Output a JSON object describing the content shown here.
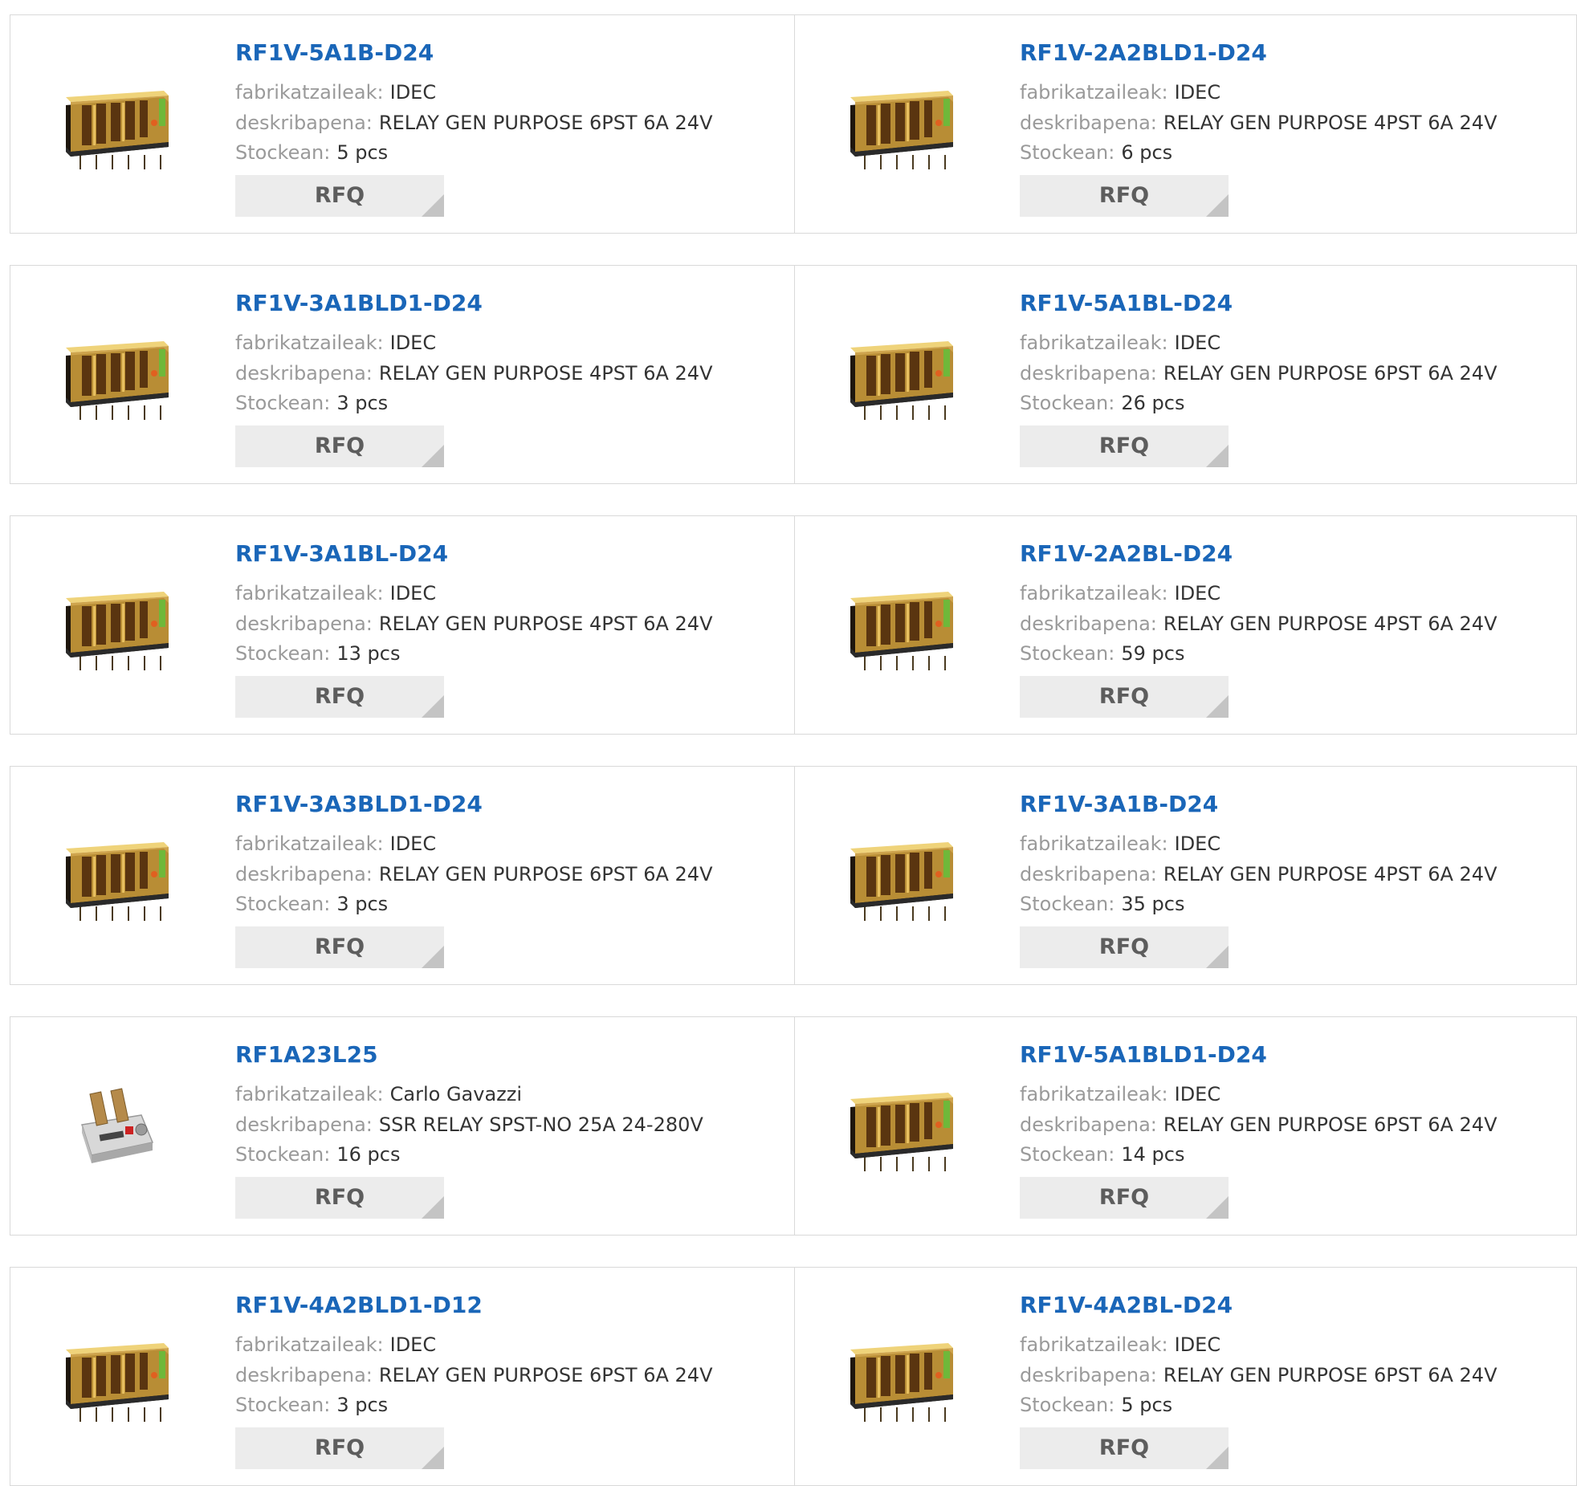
{
  "labels": {
    "manufacturer": "fabrikatzaileak:",
    "description": "deskribapena:",
    "stock": "Stockean:",
    "rfq": "RFQ"
  },
  "products": [
    {
      "pn": "RF1V-5A1B-D24",
      "manufacturer": "IDEC",
      "description": "RELAY GEN PURPOSE 6PST 6A 24V",
      "stock": "5 pcs",
      "image": "relay-icon"
    },
    {
      "pn": "RF1V-2A2BLD1-D24",
      "manufacturer": "IDEC",
      "description": "RELAY GEN PURPOSE 4PST 6A 24V",
      "stock": "6 pcs",
      "image": "relay-icon"
    },
    {
      "pn": "RF1V-3A1BLD1-D24",
      "manufacturer": "IDEC",
      "description": "RELAY GEN PURPOSE 4PST 6A 24V",
      "stock": "3 pcs",
      "image": "relay-icon"
    },
    {
      "pn": "RF1V-5A1BL-D24",
      "manufacturer": "IDEC",
      "description": "RELAY GEN PURPOSE 6PST 6A 24V",
      "stock": "26 pcs",
      "image": "relay-icon"
    },
    {
      "pn": "RF1V-3A1BL-D24",
      "manufacturer": "IDEC",
      "description": "RELAY GEN PURPOSE 4PST 6A 24V",
      "stock": "13 pcs",
      "image": "relay-icon"
    },
    {
      "pn": "RF1V-2A2BL-D24",
      "manufacturer": "IDEC",
      "description": "RELAY GEN PURPOSE 4PST 6A 24V",
      "stock": "59 pcs",
      "image": "relay-icon"
    },
    {
      "pn": "RF1V-3A3BLD1-D24",
      "manufacturer": "IDEC",
      "description": "RELAY GEN PURPOSE 6PST 6A 24V",
      "stock": "3 pcs",
      "image": "relay-icon"
    },
    {
      "pn": "RF1V-3A1B-D24",
      "manufacturer": "IDEC",
      "description": "RELAY GEN PURPOSE 4PST 6A 24V",
      "stock": "35 pcs",
      "image": "relay-icon"
    },
    {
      "pn": "RF1A23L25",
      "manufacturer": "Carlo Gavazzi",
      "description": "SSR RELAY SPST-NO 25A 24-280V",
      "stock": "16 pcs",
      "image": "ssr-icon"
    },
    {
      "pn": "RF1V-5A1BLD1-D24",
      "manufacturer": "IDEC",
      "description": "RELAY GEN PURPOSE 6PST 6A 24V",
      "stock": "14 pcs",
      "image": "relay-icon"
    },
    {
      "pn": "RF1V-4A2BLD1-D12",
      "manufacturer": "IDEC",
      "description": "RELAY GEN PURPOSE 6PST 6A 24V",
      "stock": "3 pcs",
      "image": "relay-icon"
    },
    {
      "pn": "RF1V-4A2BL-D24",
      "manufacturer": "IDEC",
      "description": "RELAY GEN PURPOSE 6PST 6A 24V",
      "stock": "5 pcs",
      "image": "relay-icon"
    }
  ],
  "colors": {
    "part_number": "#1a66b8",
    "label": "#9a9a9a",
    "value": "#333333",
    "button_bg": "#ececec",
    "button_text": "#5d5d5d",
    "border": "#d9d9d9"
  }
}
